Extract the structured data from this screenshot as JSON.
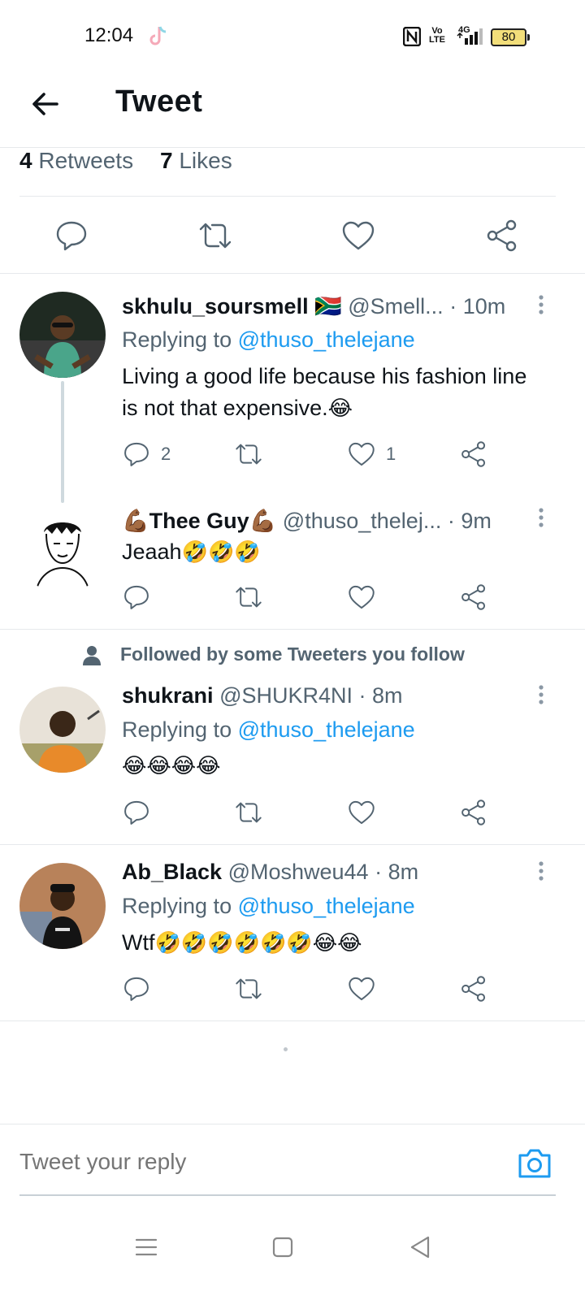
{
  "status_bar": {
    "time": "12:04",
    "volte_line1": "Vo",
    "volte_line2": "LTE",
    "network": "4G",
    "battery": "80"
  },
  "header": {
    "title": "Tweet"
  },
  "stats": {
    "retweets_count": "4",
    "retweets_label": "Retweets",
    "likes_count": "7",
    "likes_label": "Likes"
  },
  "replies": [
    {
      "name": "skhulu_soursmell",
      "flag": "🇿🇦",
      "handle": "@Smell...",
      "time": "· 10m",
      "replying_prefix": "Replying to",
      "replying_to": "@thuso_thelejane",
      "text": "Living a good life because his fashion line is not that expensive.",
      "text_emoji": "😂",
      "reply_count": "2",
      "like_count": "1"
    },
    {
      "name_prefix_emoji": "💪🏾",
      "name": "Thee Guy",
      "name_suffix_emoji": "💪🏾",
      "handle": "@thuso_thelej...",
      "time": "· 9m",
      "text": "Jeaah",
      "text_emoji": "🤣🤣🤣"
    },
    {
      "context": "Followed by some Tweeters you follow",
      "name": "shukrani",
      "handle": "@SHUKR4NI",
      "time": "· 8m",
      "replying_prefix": "Replying to",
      "replying_to": "@thuso_thelejane",
      "text_emoji": "😂😂😂😂"
    },
    {
      "name": "Ab_Black",
      "handle": "@Moshweu44",
      "time": "· 8m",
      "replying_prefix": "Replying to",
      "replying_to": "@thuso_thelejane",
      "text": "Wtf",
      "text_emoji": "🤣🤣🤣🤣🤣🤣😂😂"
    }
  ],
  "composer": {
    "placeholder": "Tweet your reply"
  },
  "icons": {
    "back": "arrow-left-icon",
    "reply": "speech-bubble-icon",
    "retweet": "retweet-icon",
    "like": "heart-icon",
    "share": "share-icon",
    "more": "vertical-ellipsis-icon",
    "camera": "camera-icon"
  },
  "colors": {
    "accent": "#1d9bf0",
    "secondary_text": "#536471",
    "primary_text": "#0f1419",
    "battery_fill": "#f2de7a"
  }
}
